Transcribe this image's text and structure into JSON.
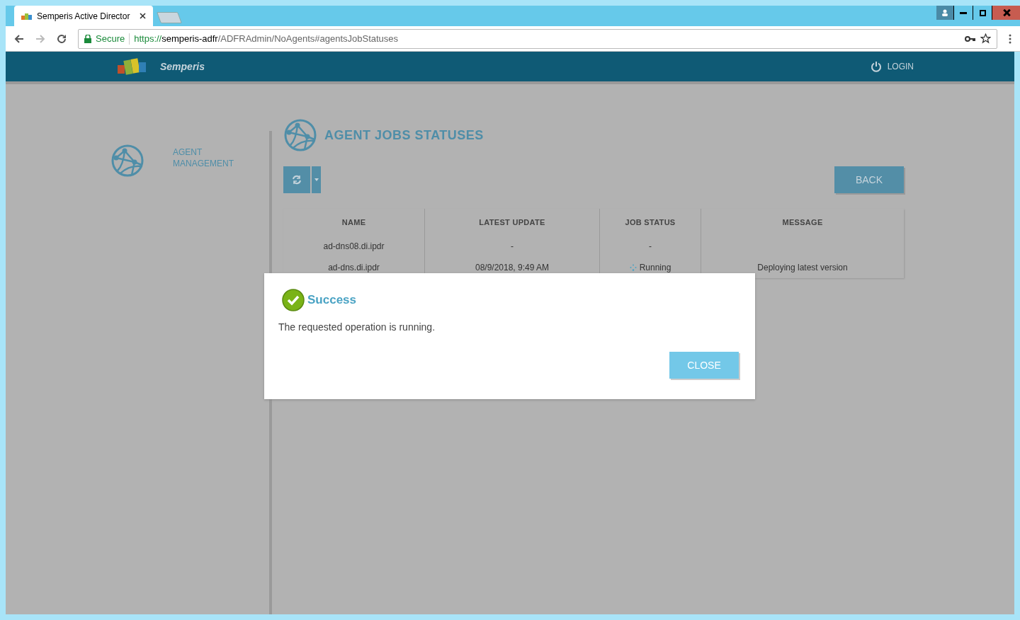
{
  "browser": {
    "tab_title": "Semperis Active Director",
    "secure_label": "Secure",
    "url_scheme": "https://",
    "url_host": "semperis-adfr",
    "url_path": "/ADFRAdmin/NoAgents#agentsJobStatuses"
  },
  "header": {
    "brand": "Semperis",
    "login": "LOGIN"
  },
  "sidebar": {
    "items": [
      {
        "label": "AGENT MANAGEMENT"
      }
    ]
  },
  "page": {
    "title": "AGENT JOBS STATUSES",
    "back_button": "BACK"
  },
  "table": {
    "columns": [
      "NAME",
      "LATEST UPDATE",
      "JOB STATUS",
      "MESSAGE"
    ],
    "rows": [
      {
        "name": "ad-dns08.di.ipdr",
        "latest_update": "-",
        "job_status": "-",
        "running": false,
        "message": ""
      },
      {
        "name": "ad-dns.di.ipdr",
        "latest_update": "08/9/2018, 9:49 AM",
        "job_status": "Running",
        "running": true,
        "message": "Deploying latest version"
      }
    ]
  },
  "dialog": {
    "title": "Success",
    "message": "The requested operation is running.",
    "close_button": "CLOSE"
  }
}
